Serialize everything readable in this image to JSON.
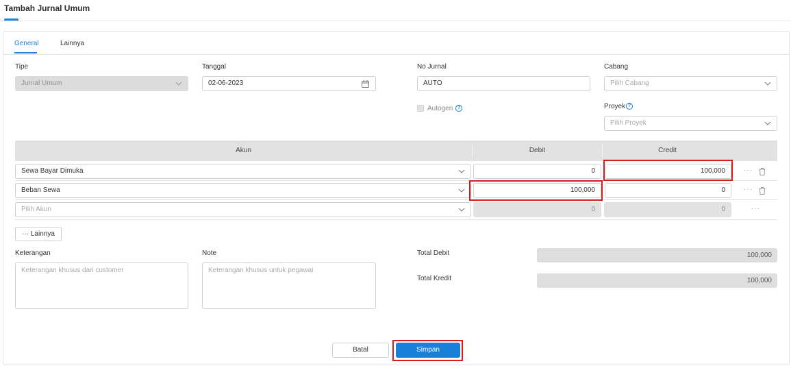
{
  "page": {
    "title": "Tambah Jurnal Umum"
  },
  "tabs": [
    {
      "label": "General",
      "active": true
    },
    {
      "label": "Lainnya",
      "active": false
    }
  ],
  "form": {
    "tipe": {
      "label": "Tipe",
      "value": "Jurnal Umum"
    },
    "tanggal": {
      "label": "Tanggal",
      "value": "02-06-2023"
    },
    "no_jurnal": {
      "label": "No Jurnal",
      "value": "AUTO"
    },
    "autogen": {
      "label": "Autogen",
      "checked": false
    },
    "cabang": {
      "label": "Cabang",
      "placeholder": "Pilih Cabang"
    },
    "proyek": {
      "label": "Proyek",
      "placeholder": "Pilih Proyek"
    }
  },
  "table": {
    "headers": {
      "akun": "Akun",
      "debit": "Debit",
      "credit": "Credit"
    },
    "rows": [
      {
        "akun": "Sewa Bayar Dimuka",
        "debit": "0",
        "credit": "100,000"
      },
      {
        "akun": "Beban Sewa",
        "debit": "100,000",
        "credit": "0"
      },
      {
        "akun": "Pilih Akun",
        "debit": "0",
        "credit": "0"
      }
    ],
    "more_label": "···",
    "lainnya_button": "··· Lainnya"
  },
  "footer": {
    "keterangan": {
      "label": "Keterangan",
      "placeholder": "Keterangan khusus dari customer"
    },
    "note": {
      "label": "Note",
      "placeholder": "Keterangan khusus untuk pegawai"
    },
    "total_debit": {
      "label": "Total Debit",
      "value": "100,000"
    },
    "total_kredit": {
      "label": "Total Kredit",
      "value": "100,000"
    }
  },
  "actions": {
    "cancel": "Batal",
    "save": "Simpan"
  },
  "colors": {
    "accent": "#1a7fd6",
    "highlight": "#d81b1b"
  }
}
